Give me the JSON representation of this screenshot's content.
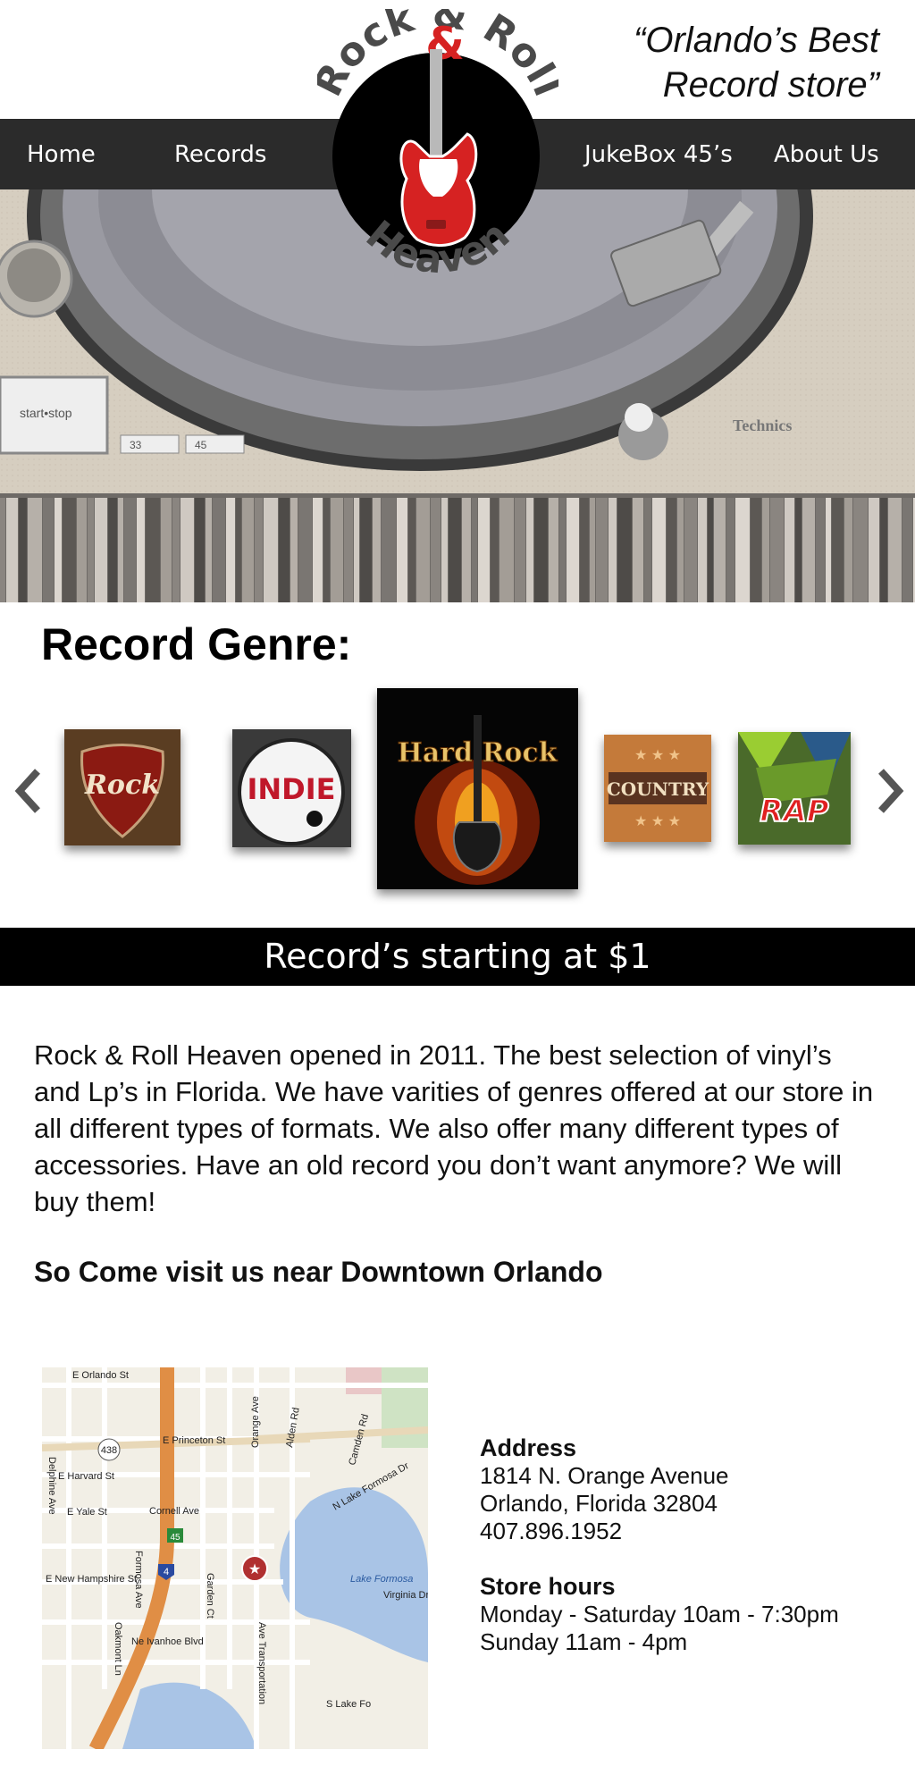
{
  "header": {
    "tagline_line1": "“Orlando’s Best",
    "tagline_line2": "Record store”"
  },
  "logo": {
    "top_text": "Rock & Roll",
    "bottom_text": "Heaven",
    "accent_color": "#d62222"
  },
  "nav": {
    "home": "Home",
    "records": "Records",
    "jukebox": "JukeBox 45’s",
    "about": "About Us"
  },
  "hero": {
    "button_label": "start•stop",
    "speed_33": "33",
    "speed_45": "45",
    "brand": "Technics"
  },
  "genre": {
    "title": "Record Genre:",
    "tiles": [
      "Rock",
      "INDIE",
      "Hard Rock",
      "COUNTRY",
      "RAP"
    ]
  },
  "banner": {
    "text": "Record’s starting at $1"
  },
  "about": {
    "text": "Rock & Roll Heaven opened in 2011. The best selection of vinyl’s and Lp’s in Florida.  We have varities of genres offered at our store in all different types of formats. We also offer many different types of accessories. Have an old record you don’t want anymore? We will buy them!",
    "visit": "So Come visit us near Downtown Orlando"
  },
  "map": {
    "streets": [
      "E Orlando St",
      "E Princeton St",
      "E Harvard St",
      "E Yale St",
      "Cornell Ave",
      "E New Hampshire St",
      "Ne Ivanhoe Blvd",
      "Orange Ave",
      "Alden Rd",
      "Camden Rd",
      "N Lake Formosa Dr",
      "Lake Formosa",
      "S Lake Fo",
      "Virginia Dr",
      "Formosa Ave",
      "Garden Ct",
      "Oakmont Ln",
      "Delphine Ave",
      "Ave Transportation"
    ],
    "route_labels": [
      "438",
      "45",
      "4"
    ]
  },
  "address": {
    "heading": "Address",
    "line1": "1814 N. Orange Avenue",
    "line2": "Orlando, Florida 32804",
    "phone": "407.896.1952"
  },
  "hours": {
    "heading": "Store hours",
    "line1": "Monday - Saturday 10am - 7:30pm",
    "line2": "Sunday 11am - 4pm"
  }
}
